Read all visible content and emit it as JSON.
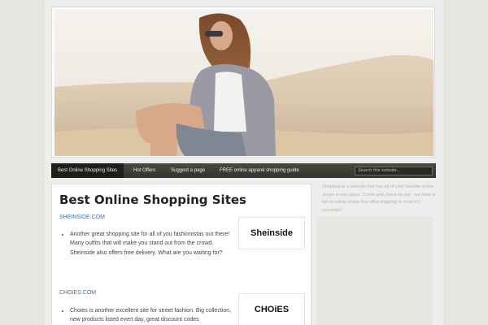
{
  "nav": {
    "items": [
      {
        "label": "Best Online Shopping Sites",
        "active": true
      },
      {
        "label": "Hot Offers",
        "active": false
      },
      {
        "label": "Suggest a page",
        "active": false
      },
      {
        "label": "FREE online apparel shopping guide",
        "active": false
      }
    ],
    "search_placeholder": "Search this website..."
  },
  "sidebar": {
    "text": "Shoptrap is a website that has all of your favorite online shops in one place. Come and check us out - we have a list of online shops that offer shipping to most EU countries!"
  },
  "main": {
    "title": "Best Online Shopping Sites",
    "sites": [
      {
        "name": "SHEINSIDE.COM",
        "description": "Another great shopping site for all of you fashionistas out there! Many outfits that will make you stand out from the crowd. Sheinside also offers free delivery. What are you waiting for?",
        "logo": "Sheinside"
      },
      {
        "name": "CHOIES.COM",
        "description": "Choies is another excellent site for street fashion. Big collection, new products listed evert day, great discount codes",
        "logo": "CHOiES"
      }
    ]
  },
  "colors": {
    "nav_bg": "#3c3c35",
    "link": "#3b6fa6",
    "sidebar_text": "#b3b3ab"
  }
}
